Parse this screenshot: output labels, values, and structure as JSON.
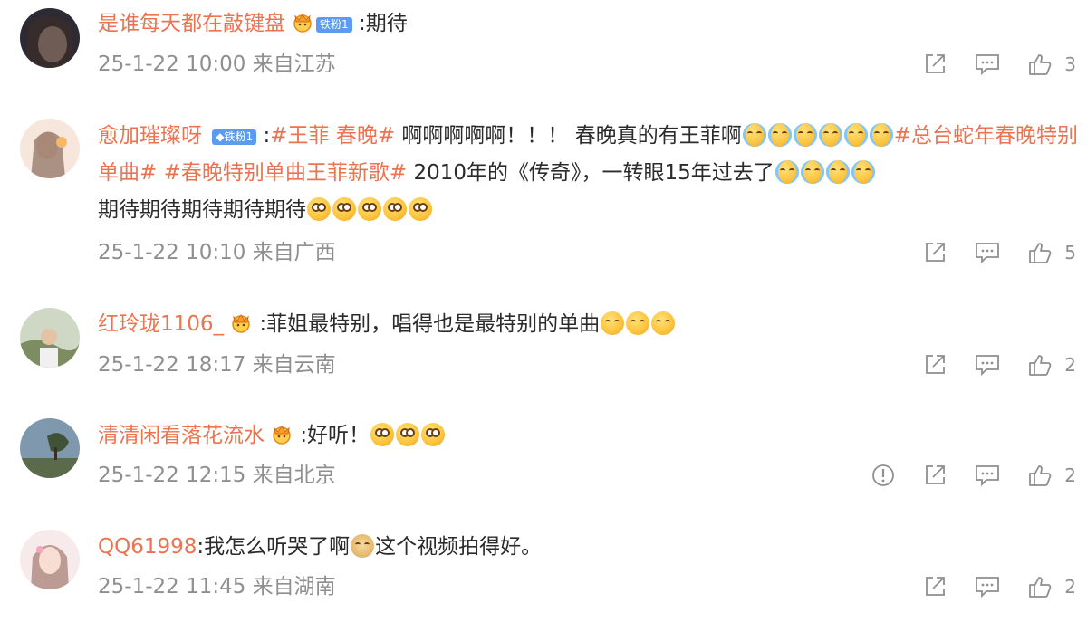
{
  "comments": [
    {
      "username": "是谁每天都在敲键盘",
      "fan_label": "铁粉1",
      "content_before": ":期待",
      "timestamp": "25-1-22 10:00",
      "location": "来自江苏",
      "likes": "3",
      "avatar_color": "#3a2f3a"
    },
    {
      "username": "愈加璀璨呀",
      "fan_label": "铁粉1",
      "sep": ":",
      "tag1": "#王菲 春晚#",
      "text1": " 啊啊啊啊啊！！！ 春晚真的有王菲啊",
      "tag2": "#总台蛇年春晚特别单曲#",
      "tag3": "#春晚特别单曲王菲新歌#",
      "text2": " 2010年的《传奇》，一转眼15年过去了",
      "text3": "期待期待期待期待期待",
      "timestamp": "25-1-22 10:10",
      "location": "来自广西",
      "likes": "5",
      "avatar_color": "#f2dccc"
    },
    {
      "username": "红玲珑1106_",
      "content_before": ":菲姐最特别，唱得也是最特别的单曲",
      "timestamp": "25-1-22 18:17",
      "location": "来自云南",
      "likes": "2",
      "avatar_color": "#9aa58a"
    },
    {
      "username": "清清闲看落花流水",
      "content_before": ":好听！",
      "timestamp": "25-1-22 12:15",
      "location": "来自北京",
      "likes": "2",
      "avatar_color": "#6f8ea8"
    },
    {
      "username": "QQ61998",
      "content_before": ":我怎么听哭了啊",
      "content_after": "这个视频拍得好。",
      "timestamp": "25-1-22 11:45",
      "location": "来自湖南",
      "likes": "2",
      "avatar_color": "#f3e3e3"
    }
  ],
  "icons": {
    "share": "share-icon",
    "comment": "comment-icon",
    "like": "like-icon",
    "report": "report-icon"
  },
  "colors": {
    "username": "#eb7350",
    "meta": "#8f8f8f",
    "text": "#2b2b2b",
    "fan_badge": "#5b9bf2"
  }
}
